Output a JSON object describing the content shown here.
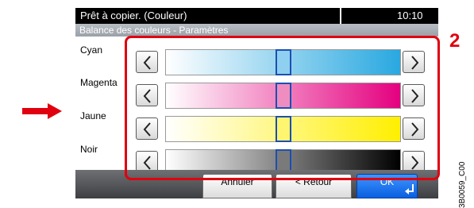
{
  "status_bar": {
    "title": "Prêt à copier. (Couleur)",
    "time": "10:10"
  },
  "subtitle": "Balance des couleurs - Paramètres",
  "rows": [
    {
      "label": "Cyan",
      "color": "#29a8e0"
    },
    {
      "label": "Magenta",
      "color": "#e4007f"
    },
    {
      "label": "Jaune",
      "color": "#ffef00"
    },
    {
      "label": "Noir",
      "color": "#000000"
    }
  ],
  "level_center": 0.5,
  "buttons": {
    "cancel": "Annuler",
    "back": "< Retour",
    "ok": "OK"
  },
  "callout": "2",
  "figure_code": "3B0059_C00"
}
